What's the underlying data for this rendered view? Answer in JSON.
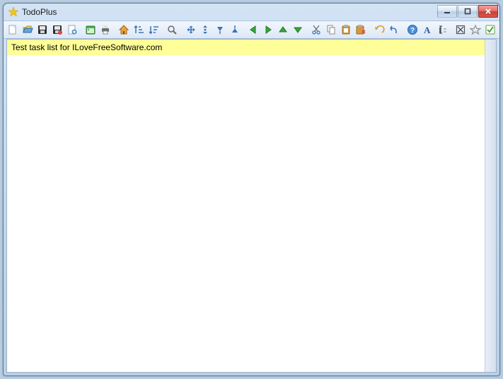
{
  "window": {
    "title": "TodoPlus"
  },
  "toolbar": {
    "new": "New",
    "open": "Open",
    "save": "Save",
    "saveas": "Save As",
    "export": "Export",
    "calendar": "Calendar",
    "print": "Print",
    "home": "Home",
    "sort_asc": "Sort Asc",
    "sort_desc": "Sort Desc",
    "find": "Find",
    "expand_all": "Expand All",
    "collapse_all": "Collapse All",
    "expand": "Expand",
    "collapse": "Collapse",
    "back": "Back",
    "forward": "Forward",
    "up": "Up",
    "down": "Down",
    "cut": "Cut",
    "copy": "Copy",
    "paste": "Paste",
    "paste_special": "Paste Special",
    "undo": "Undo",
    "redo": "Redo",
    "help": "Help",
    "font": "Font",
    "rename": "Rename",
    "complete": "Complete",
    "star": "Star",
    "check": "Check"
  },
  "tasks": [
    {
      "text": "Test task list for ILoveFreeSoftware.com",
      "highlight": "#ffff99",
      "selected": true
    }
  ]
}
